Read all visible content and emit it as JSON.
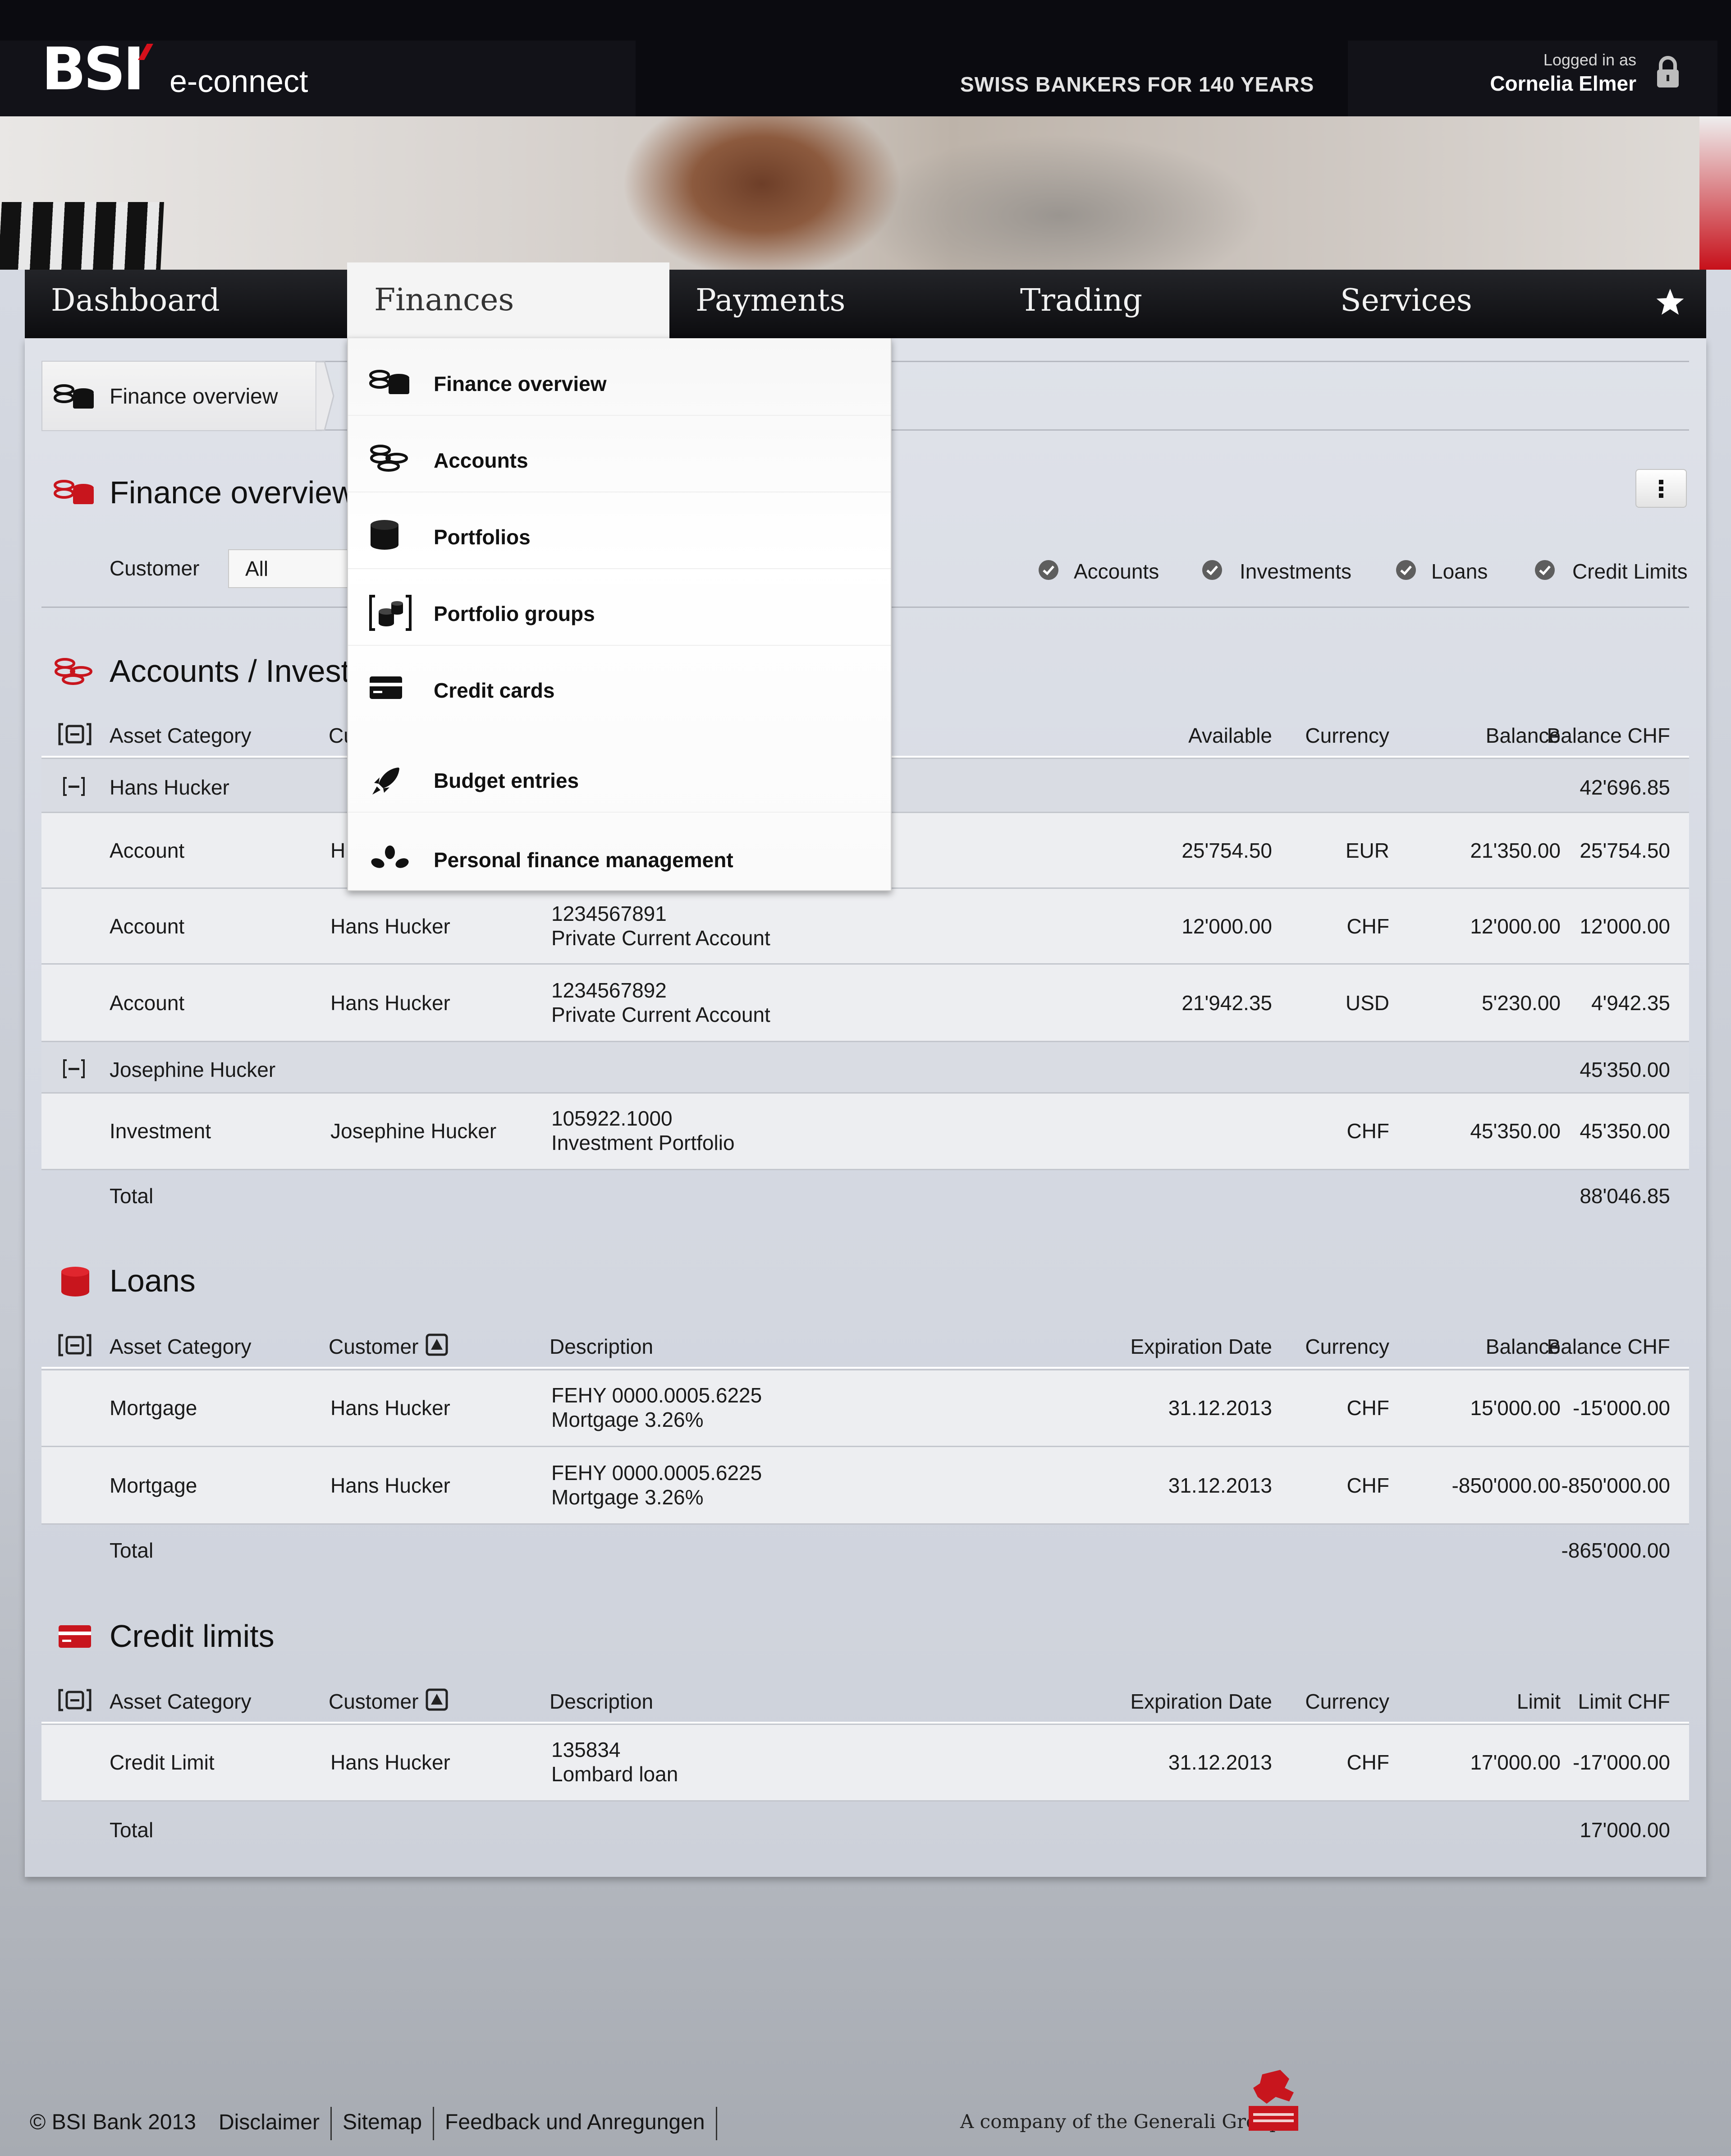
{
  "header": {
    "logo": "BSI",
    "product": "e-connect",
    "slogan": "SWISS BANKERS FOR 140 YEARS",
    "logged_in_label": "Logged in as",
    "user_name": "Cornelia Elmer"
  },
  "nav": {
    "items": [
      "Dashboard",
      "Finances",
      "Payments",
      "Trading",
      "Services"
    ],
    "active": "Finances"
  },
  "breadcrumb": {
    "label": "Finance overview"
  },
  "finances_menu": {
    "items": [
      {
        "label": "Finance overview",
        "icon": "coins-stack-icon"
      },
      {
        "label": "Accounts",
        "icon": "coins-icon"
      },
      {
        "label": "Portfolios",
        "icon": "cylinder-icon"
      },
      {
        "label": "Portfolio groups",
        "icon": "portfolio-group-icon"
      },
      {
        "label": "Credit cards",
        "icon": "credit-card-icon"
      },
      {
        "label": "Budget entries",
        "icon": "rocket-icon"
      },
      {
        "label": "Personal finance management",
        "icon": "leaves-icon"
      }
    ]
  },
  "page": {
    "title": "Finance overview",
    "customer_label": "Customer",
    "customer_value": "All",
    "filters": [
      "Accounts",
      "Investments",
      "Loans",
      "Credit Limits"
    ]
  },
  "accounts": {
    "title": "Accounts / Investments",
    "title_visible": "Accounts / Investr",
    "headers": {
      "asset": "Asset Category",
      "customer": "Cu",
      "available": "Available",
      "currency": "Currency",
      "balance": "Balance",
      "balance_chf": "Balance CHF"
    },
    "groups": [
      {
        "name": "Hans Hucker",
        "total": "42'696.85",
        "rows": [
          {
            "category": "Account",
            "customer": "H",
            "number": "",
            "description": "",
            "available": "25'754.50",
            "currency": "EUR",
            "balance": "21'350.00",
            "balance_chf": "25'754.50"
          },
          {
            "category": "Account",
            "customer": "Hans Hucker",
            "number": "1234567891",
            "description": "Private Current Account",
            "available": "12'000.00",
            "currency": "CHF",
            "balance": "12'000.00",
            "balance_chf": "12'000.00"
          },
          {
            "category": "Account",
            "customer": "Hans Hucker",
            "number": "1234567892",
            "description": "Private Current Account",
            "available": "21'942.35",
            "currency": "USD",
            "balance": "5'230.00",
            "balance_chf": "4'942.35"
          }
        ]
      },
      {
        "name": "Josephine Hucker",
        "total": "45'350.00",
        "rows": [
          {
            "category": "Investment",
            "customer": "Josephine Hucker",
            "number": "105922.1000",
            "description": "Investment Portfolio",
            "available": "",
            "currency": "CHF",
            "balance": "45'350.00",
            "balance_chf": "45'350.00"
          }
        ]
      }
    ],
    "total_label": "Total",
    "total": "88'046.85"
  },
  "loans": {
    "title": "Loans",
    "headers": {
      "asset": "Asset Category",
      "customer": "Customer",
      "description": "Description",
      "expiration": "Expiration Date",
      "currency": "Currency",
      "balance": "Balance",
      "balance_chf": "Balance CHF"
    },
    "rows": [
      {
        "category": "Mortgage",
        "customer": "Hans Hucker",
        "number": "FEHY 0000.0005.6225",
        "description": "Mortgage 3.26%",
        "expiration": "31.12.2013",
        "currency": "CHF",
        "balance": "15'000.00",
        "balance_chf": "-15'000.00"
      },
      {
        "category": "Mortgage",
        "customer": "Hans Hucker",
        "number": "FEHY 0000.0005.6225",
        "description": "Mortgage 3.26%",
        "expiration": "31.12.2013",
        "currency": "CHF",
        "balance": "-850'000.00",
        "balance_chf": "-850'000.00"
      }
    ],
    "total_label": "Total",
    "total": "-865'000.00"
  },
  "credit_limits": {
    "title": "Credit limits",
    "headers": {
      "asset": "Asset Category",
      "customer": "Customer",
      "description": "Description",
      "expiration": "Expiration Date",
      "currency": "Currency",
      "limit": "Limit",
      "limit_chf": "Limit CHF"
    },
    "rows": [
      {
        "category": "Credit Limit",
        "customer": "Hans Hucker",
        "number": "135834",
        "description": "Lombard loan",
        "expiration": "31.12.2013",
        "currency": "CHF",
        "limit": "17'000.00",
        "limit_chf": "-17'000.00"
      }
    ],
    "total_label": "Total",
    "total": "17'000.00"
  },
  "footer": {
    "copyright": "© BSI Bank 2013",
    "links": [
      "Disclaimer",
      "Sitemap",
      "Feedback und Anregungen"
    ],
    "company_text": "A company of the Generali Group"
  },
  "colors": {
    "accent_red": "#d6101b",
    "nav_dark": "#121216",
    "panel_bg": "#dfe2e9"
  }
}
